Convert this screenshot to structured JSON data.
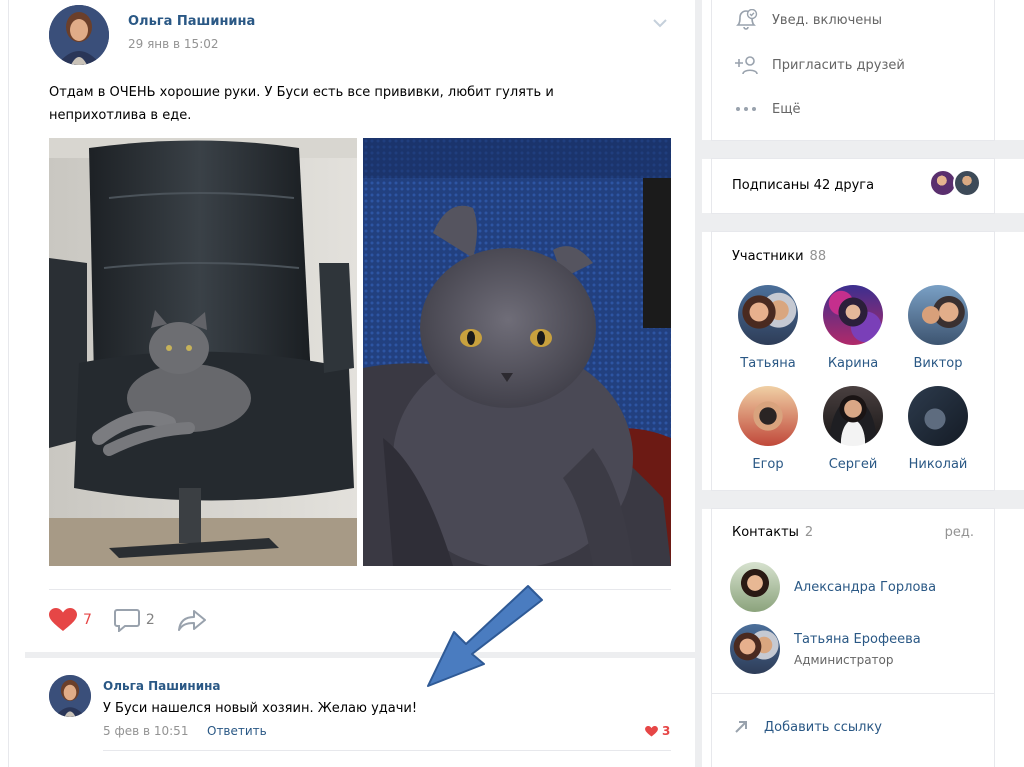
{
  "post": {
    "author": "Ольга Пашинина",
    "date": "29 янв в 15:02",
    "text": "Отдам в ОЧЕНЬ хорошие руки. У Буси есть все прививки, любит гулять и неприхотлива в еде.",
    "likes": "7",
    "comments": "2",
    "like_color": "#e64646"
  },
  "comment": {
    "author": "Ольга Пашинина",
    "text": "У Буси нашелся новый хозяин. Желаю удачи!",
    "date": "5 фев в 10:51",
    "reply_label": "Ответить",
    "likes": "3"
  },
  "sidebar": {
    "menu": [
      {
        "label": "Увед. включены",
        "icon": "bell-check-icon"
      },
      {
        "label": "Пригласить друзей",
        "icon": "add-person-icon"
      },
      {
        "label": "Ещё",
        "icon": "more-dots-icon"
      }
    ],
    "subscribed": "Подписаны 42 друга",
    "members": {
      "title": "Участники",
      "count": "88",
      "people": [
        "Татьяна",
        "Карина",
        "Виктор",
        "Егор",
        "Сергей",
        "Николай"
      ]
    },
    "contacts": {
      "title": "Контакты",
      "count": "2",
      "edit": "ред.",
      "people": [
        {
          "name": "Александра Горлова",
          "role": ""
        },
        {
          "name": "Татьяна Ерофеева",
          "role": "Администратор"
        }
      ]
    },
    "add_link": "Добавить ссылку"
  },
  "colors": {
    "link": "#2a5885",
    "accent_arrow": "#4a7cc0",
    "background": "#edeef0"
  }
}
